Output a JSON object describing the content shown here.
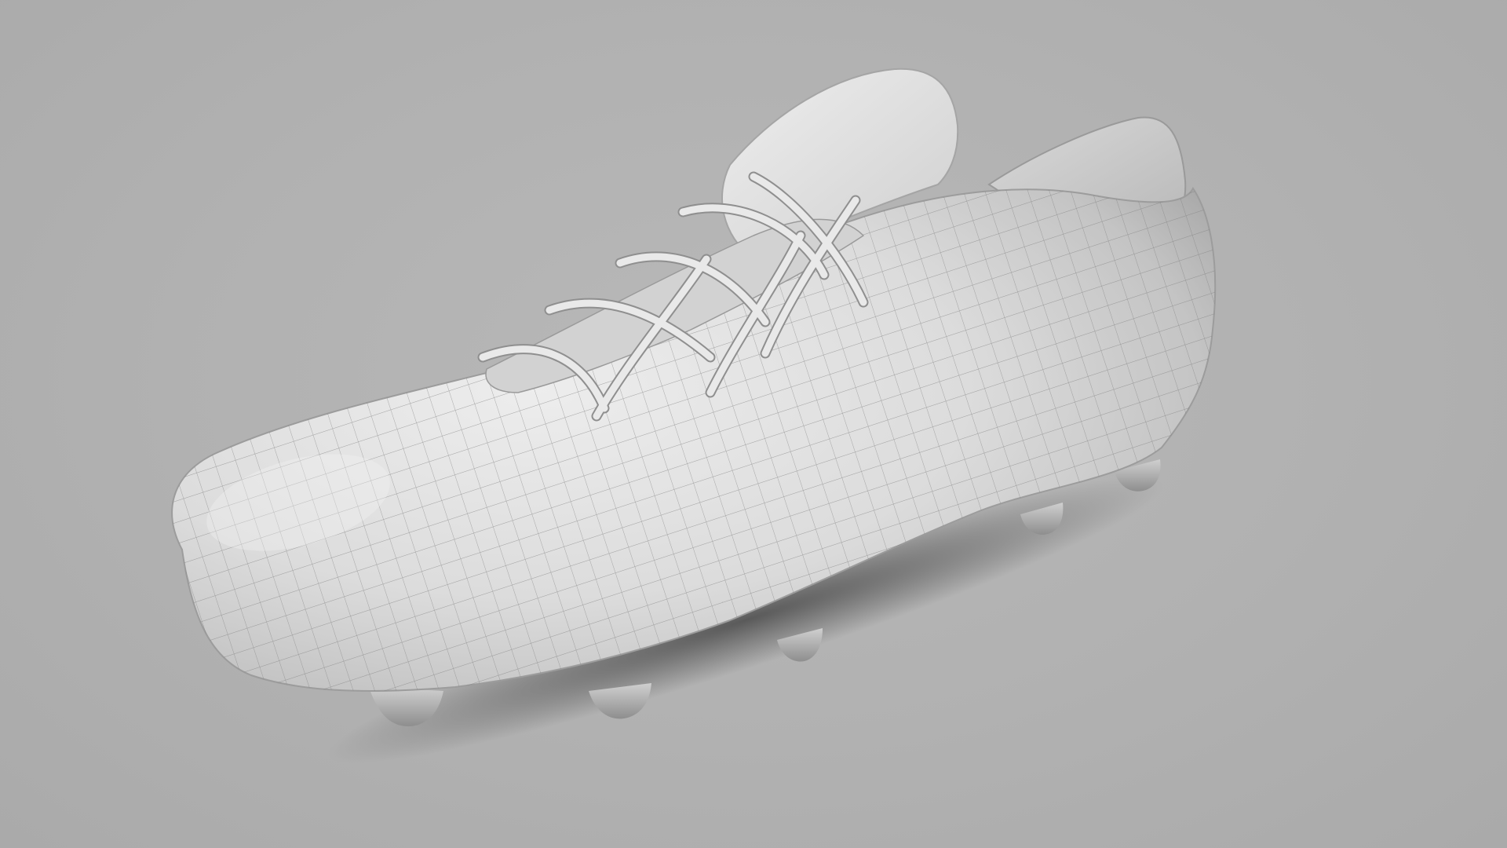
{
  "scene": {
    "subject": "football-boot-wireframe-render",
    "colors": {
      "background": "#b1b1b1",
      "surface": "#e6e6e6",
      "surface_shadow": "#9a9a9a",
      "wire": "#7d7d7d",
      "cast_shadow": "#5a5a5a"
    }
  }
}
